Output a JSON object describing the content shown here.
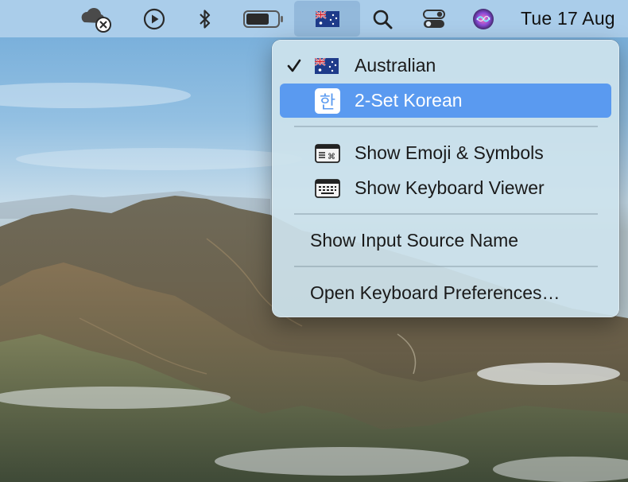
{
  "menubar": {
    "clock": "Tue 17 Aug",
    "icons": [
      "icloud-disconnected-icon",
      "play-icon",
      "bluetooth-icon",
      "battery-icon",
      "australia-flag-icon",
      "search-icon",
      "control-center-icon",
      "siri-icon"
    ]
  },
  "input_menu": {
    "items": [
      {
        "label": "Australian",
        "icon": "australia-flag-icon",
        "checked": true
      },
      {
        "label": "2-Set Korean",
        "icon": "hangul-icon",
        "icon_text": "한",
        "highlighted": true
      },
      {
        "label": "Show Emoji & Symbols",
        "icon": "emoji-symbols-icon"
      },
      {
        "label": "Show Keyboard Viewer",
        "icon": "keyboard-viewer-icon"
      },
      {
        "label": "Show Input Source Name"
      },
      {
        "label": "Open Keyboard Preferences…"
      }
    ]
  },
  "colors": {
    "highlight": "#5a9af0",
    "menubar": "#b2d2ec"
  }
}
